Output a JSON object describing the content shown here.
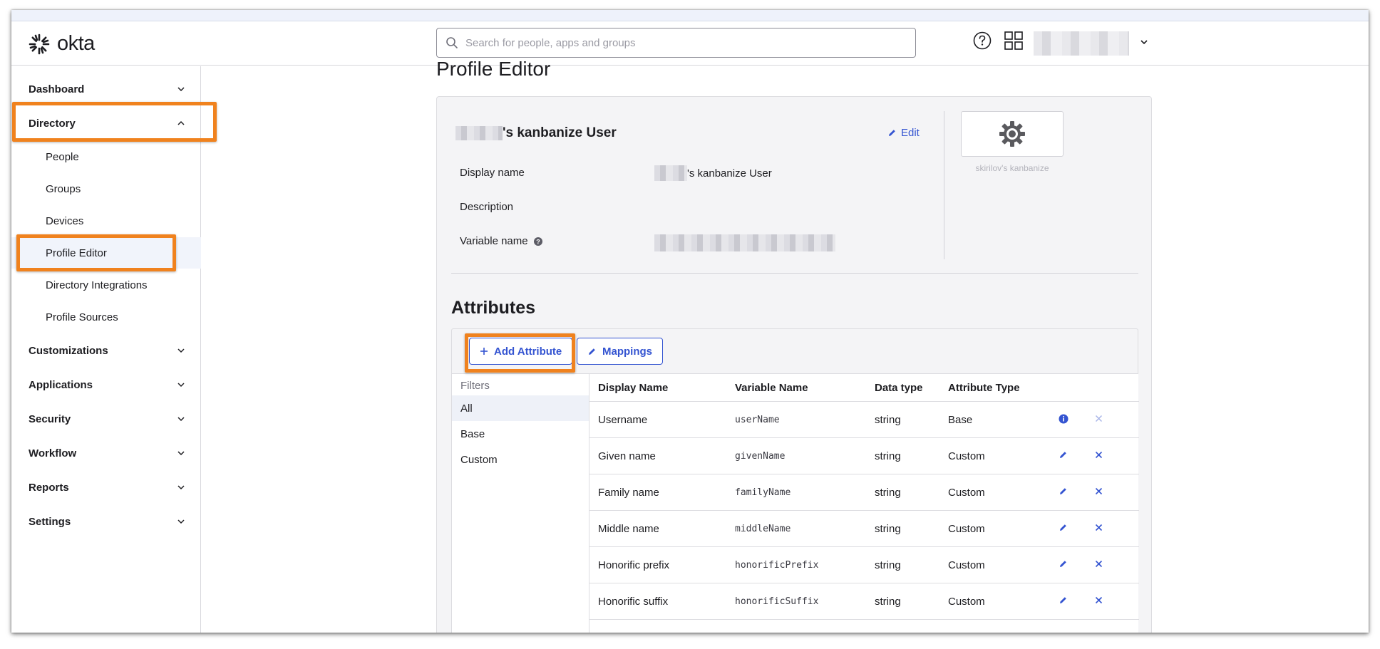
{
  "header": {
    "logo_text": "okta",
    "search_placeholder": "Search for people, apps and groups"
  },
  "sidebar": {
    "dashboard": "Dashboard",
    "directory": "Directory",
    "directory_children": [
      "People",
      "Groups",
      "Devices",
      "Profile Editor",
      "Directory Integrations",
      "Profile Sources"
    ],
    "customizations": "Customizations",
    "applications": "Applications",
    "security": "Security",
    "workflow": "Workflow",
    "reports": "Reports",
    "settings": "Settings"
  },
  "main": {
    "page_title": "Profile Editor",
    "profile_title_suffix": "'s kanbanize User",
    "edit_label": "Edit",
    "fields": {
      "display_name_label": "Display name",
      "display_name_value_suffix": "'s kanbanize User",
      "description_label": "Description",
      "variable_name_label": "Variable name"
    },
    "app_caption": "skirilov's kanbanize",
    "attributes_title": "Attributes",
    "add_attribute_label": "Add Attribute",
    "mappings_label": "Mappings",
    "filters": {
      "title": "Filters",
      "items": [
        "All",
        "Base",
        "Custom"
      ]
    },
    "table": {
      "columns": [
        "Display Name",
        "Variable Name",
        "Data type",
        "Attribute Type"
      ],
      "rows": [
        {
          "display": "Username",
          "variable": "userName",
          "type": "string",
          "attr": "Base"
        },
        {
          "display": "Given name",
          "variable": "givenName",
          "type": "string",
          "attr": "Custom"
        },
        {
          "display": "Family name",
          "variable": "familyName",
          "type": "string",
          "attr": "Custom"
        },
        {
          "display": "Middle name",
          "variable": "middleName",
          "type": "string",
          "attr": "Custom"
        },
        {
          "display": "Honorific prefix",
          "variable": "honorificPrefix",
          "type": "string",
          "attr": "Custom"
        },
        {
          "display": "Honorific suffix",
          "variable": "honorificSuffix",
          "type": "string",
          "attr": "Custom"
        }
      ]
    }
  },
  "colors": {
    "accent": "#3454d1",
    "highlight": "#f0821e",
    "text": "#1d1d21"
  }
}
